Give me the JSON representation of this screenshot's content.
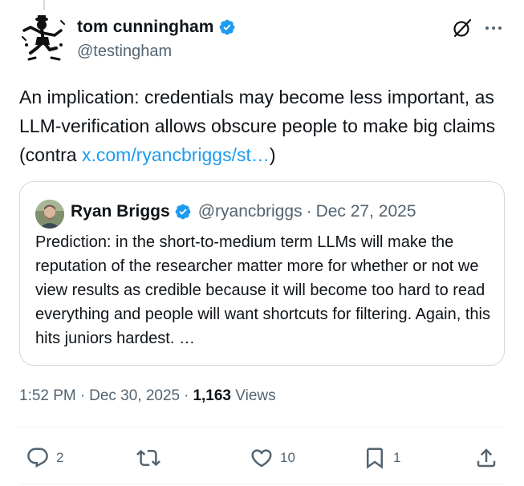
{
  "author": {
    "display_name": "tom cunningham",
    "handle": "@testingham",
    "verified": true
  },
  "tweet": {
    "text_before_link": "An implication: credentials may become less important, as LLM-verification allows obscure people to make big claims (contra ",
    "link_text": "x.com/ryancbriggs/st…",
    "text_after_link": ")"
  },
  "quoted_tweet": {
    "display_name": "Ryan Briggs",
    "handle": "@ryancbriggs",
    "separator": "·",
    "date": "Dec 27, 2025",
    "verified": true,
    "text": "Prediction: in the short-to-medium term LLMs will make the reputation of the researcher matter more for whether or not we view results as credible because it will become too hard to read everything and people will want shortcuts for filtering. Again, this hits juniors hardest. …"
  },
  "meta": {
    "time": "1:52 PM",
    "separator": "·",
    "date": "Dec 30, 2025",
    "views_count": "1,163",
    "views_label": "Views"
  },
  "actions": {
    "replies": "2",
    "retweets": "",
    "likes": "10",
    "bookmarks": "1"
  },
  "icons": {
    "header": [
      "grok-icon",
      "more-icon"
    ],
    "actions": [
      "reply-icon",
      "retweet-icon",
      "like-icon",
      "bookmark-icon",
      "share-icon"
    ]
  },
  "colors": {
    "link": "#1d9bf0",
    "verified": "#1d9bf0",
    "secondary_text": "#536471",
    "primary_text": "#0f1419",
    "border": "#cfd9de"
  }
}
